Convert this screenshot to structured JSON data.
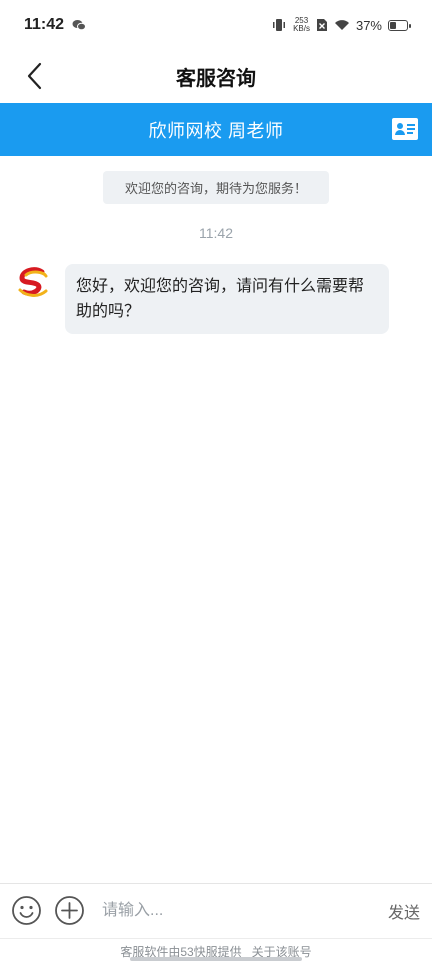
{
  "status_bar": {
    "time": "11:42",
    "net_speed_value": "253",
    "net_speed_unit": "KB/s",
    "battery_percent": "37%",
    "battery_level": 0.37
  },
  "nav": {
    "title": "客服咨询"
  },
  "agent_bar": {
    "title": "欣师网校 周老师",
    "color": "#1a9bf0"
  },
  "chat": {
    "welcome_tip": "欢迎您的咨询，期待为您服务！",
    "timestamp": "11:42",
    "messages": [
      {
        "sender": "agent",
        "text": "您好，欢迎您的咨询，请问有什么需要帮助的吗？"
      }
    ]
  },
  "input_bar": {
    "placeholder": "请输入...",
    "send_label": "发送"
  },
  "footer": {
    "provider_text": "客服软件由53快服提供",
    "about_link": "关于该账号"
  },
  "icons": {
    "back": "chevron-left-icon",
    "card": "contact-card-icon",
    "emoji": "smiley-icon",
    "plus": "plus-circle-icon",
    "avatar": "school-logo"
  }
}
